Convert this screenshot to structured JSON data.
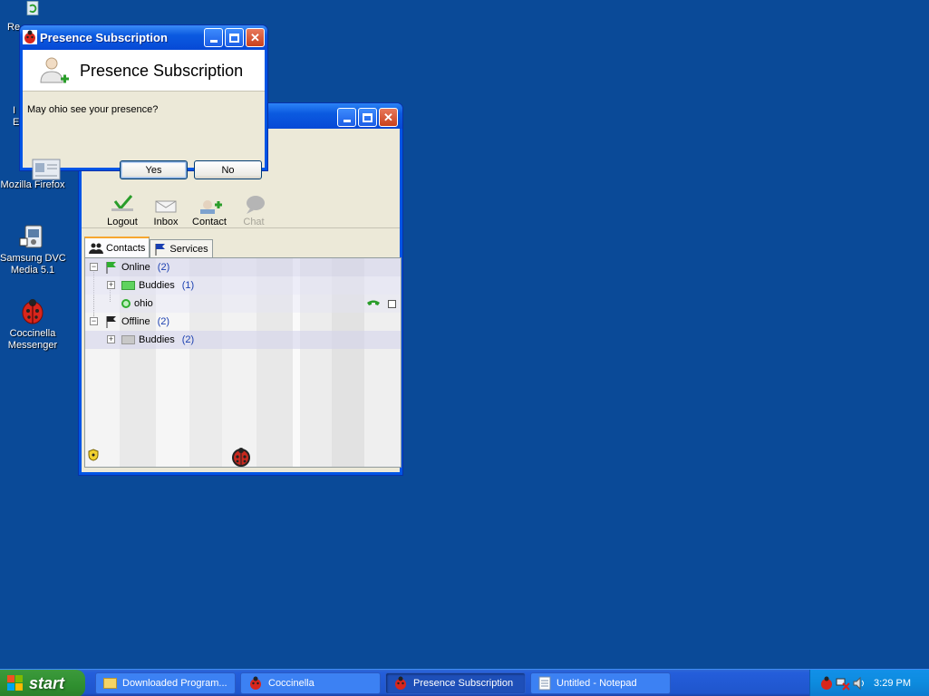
{
  "desktop": {
    "icons": [
      {
        "label": "Re"
      },
      {
        "label": "I\nE"
      },
      {
        "label": "Mozilla Firefox"
      },
      {
        "label": "Samsung DVC\nMedia 5.1"
      },
      {
        "label": "Coccinella\nMessenger"
      }
    ]
  },
  "main_window": {
    "toolbar": {
      "logout": "Logout",
      "inbox": "Inbox",
      "contact": "Contact",
      "chat": "Chat"
    },
    "tabs": [
      {
        "label": "Contacts"
      },
      {
        "label": "Services"
      }
    ],
    "tree": {
      "online": {
        "label": "Online",
        "count": "(2)"
      },
      "online_buddies": {
        "label": "Buddies",
        "count": "(1)"
      },
      "contact_ohio": {
        "label": "ohio"
      },
      "offline": {
        "label": "Offline",
        "count": "(2)"
      },
      "offline_buddies": {
        "label": "Buddies",
        "count": "(2)"
      }
    }
  },
  "dialog": {
    "title": "Presence Subscription",
    "heading": "Presence Subscription",
    "message": "May ohio see your presence?",
    "yes_label": "Yes",
    "no_label": "No"
  },
  "taskbar": {
    "start_label": "start",
    "tasks": [
      {
        "label": "Downloaded Program..."
      },
      {
        "label": "Coccinella"
      },
      {
        "label": "Presence Subscription"
      },
      {
        "label": "Untitled - Notepad"
      }
    ],
    "clock": "3:29 PM"
  },
  "colors": {
    "desktop": "#0a4a98",
    "titlebar": "#0649d6",
    "dialog_face": "#ece9d8",
    "count_text": "#1a3fb0"
  }
}
